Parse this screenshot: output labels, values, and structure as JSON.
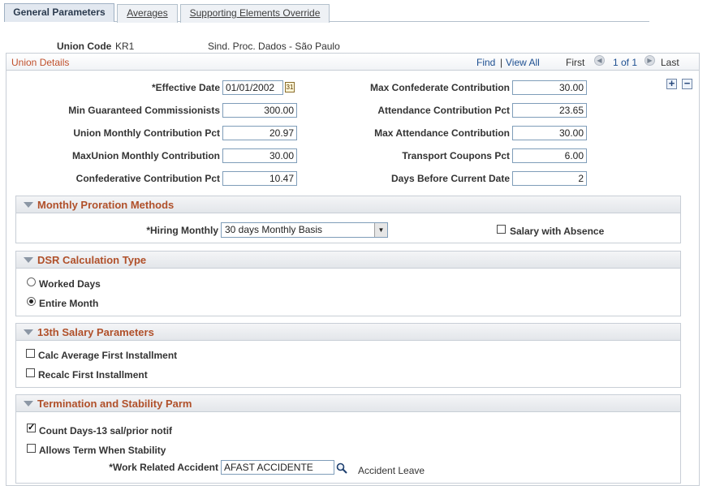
{
  "tabs": [
    {
      "label": "General Parameters"
    },
    {
      "label": "Averages"
    },
    {
      "label": "Supporting Elements Override"
    }
  ],
  "header": {
    "union_code_label": "Union Code",
    "union_code_value": "KR1",
    "union_name": "Sind. Proc. Dados - São Paulo"
  },
  "union_details": {
    "title": "Union Details",
    "find": "Find",
    "separator": "|",
    "view_all": "View All",
    "first": "First",
    "range": "1 of 1",
    "last": "Last"
  },
  "fields_left": [
    {
      "label": "*Effective Date",
      "value": "01/01/2002"
    },
    {
      "label": "Min Guaranteed Commissionists",
      "value": "300.00"
    },
    {
      "label": "Union Monthly Contribution Pct",
      "value": "20.97"
    },
    {
      "label": "MaxUnion Monthly Contribution",
      "value": "30.00"
    },
    {
      "label": "Confederative Contribution Pct",
      "value": "10.47"
    }
  ],
  "fields_right": [
    {
      "label": "Max Confederate Contribution",
      "value": "30.00"
    },
    {
      "label": "Attendance Contribution Pct",
      "value": "23.65"
    },
    {
      "label": "Max Attendance Contribution",
      "value": "30.00"
    },
    {
      "label": "Transport Coupons Pct",
      "value": "6.00"
    },
    {
      "label": "Days Before Current Date",
      "value": "2"
    }
  ],
  "monthly_proration": {
    "title": "Monthly Proration Methods",
    "hiring_label": "*Hiring Monthly",
    "hiring_value": "30 days Monthly Basis",
    "salary_absence_label": "Salary with Absence",
    "salary_absence_checked": false
  },
  "dsr": {
    "title": "DSR Calculation Type",
    "options": [
      {
        "label": "Worked Days",
        "selected": false
      },
      {
        "label": "Entire Month",
        "selected": true
      }
    ]
  },
  "salary13": {
    "title": "13th Salary Parameters",
    "options": [
      {
        "label": "Calc Average First Installment",
        "checked": false
      },
      {
        "label": "Recalc First Installment",
        "checked": false
      }
    ]
  },
  "termination": {
    "title": "Termination and Stability Parm",
    "options": [
      {
        "label": "Count Days-13 sal/prior notif",
        "checked": true
      },
      {
        "label": "Allows Term When Stability",
        "checked": false
      }
    ],
    "accident_label": "*Work Related Accident",
    "accident_value": "AFAST ACCIDENTE",
    "accident_desc": "Accident Leave"
  },
  "icons": {
    "calendar": "calendar-icon",
    "lookup": "lookup-magnifier-icon",
    "add": "add-row-icon",
    "delete": "delete-row-icon"
  }
}
